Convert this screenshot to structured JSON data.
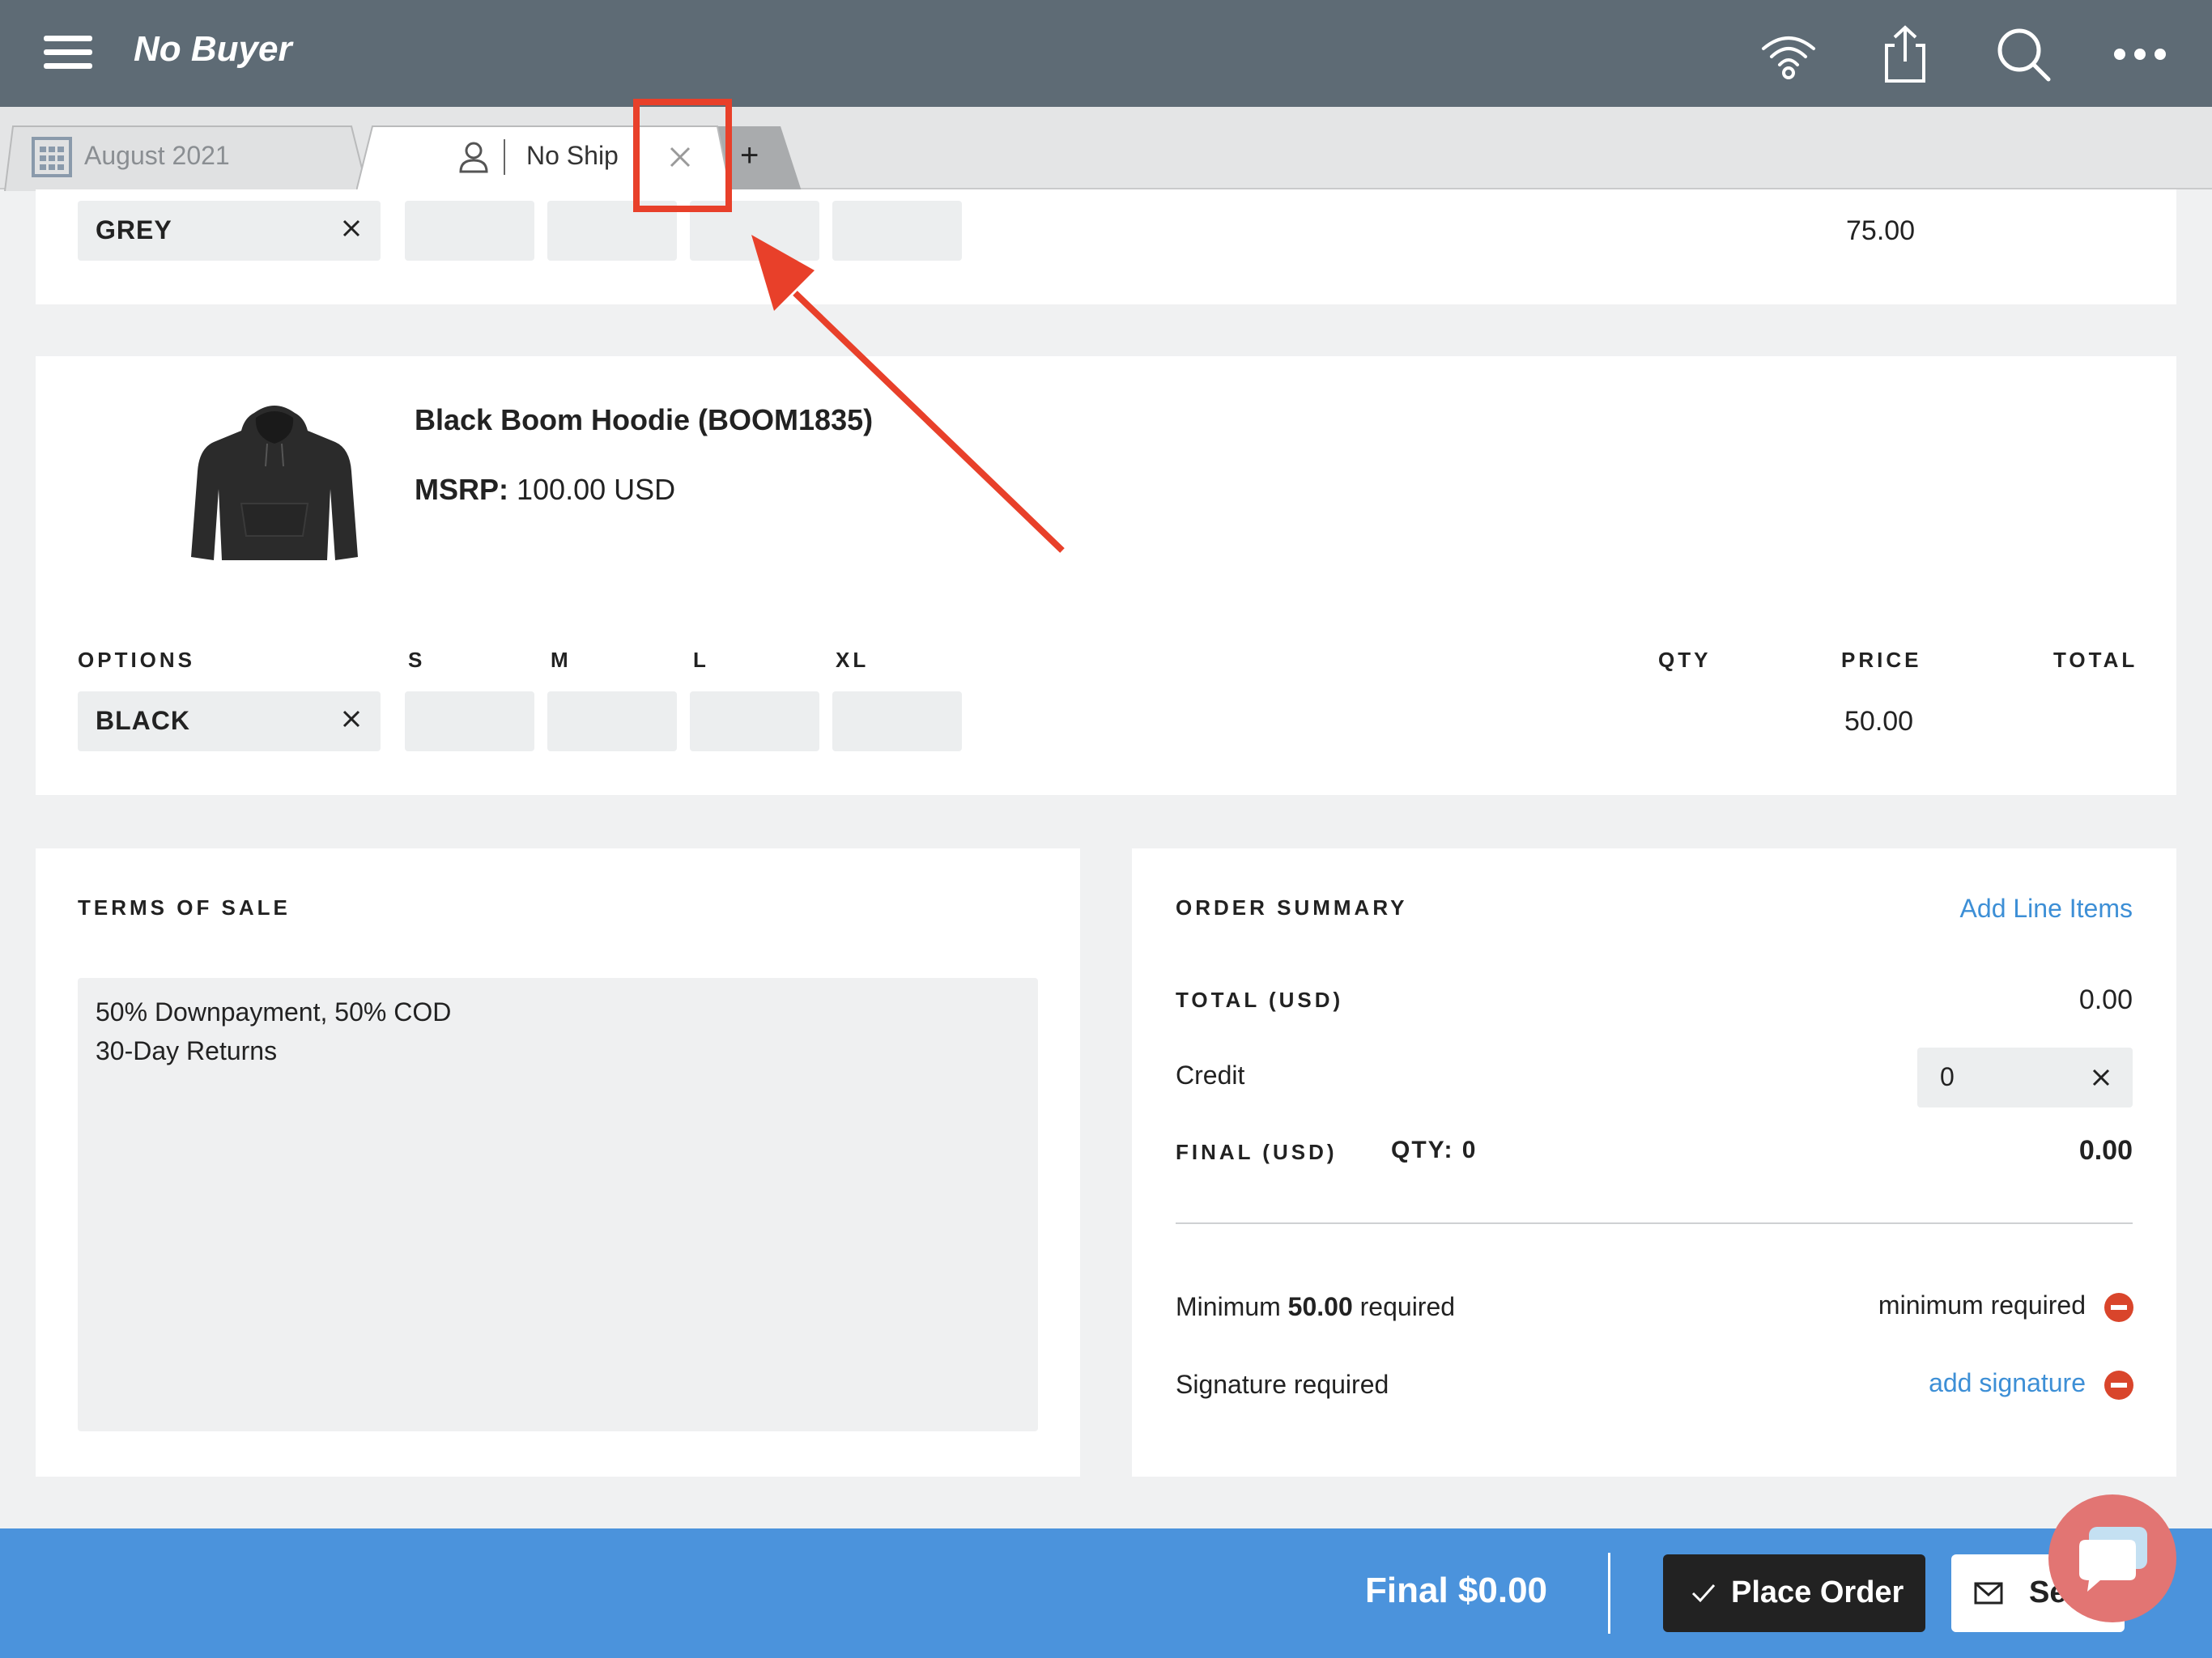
{
  "header": {
    "title": "No Buyer",
    "icons": [
      "menu-icon",
      "wifi-icon",
      "share-icon",
      "search-icon",
      "more-icon"
    ]
  },
  "tabs": [
    {
      "label": "August 2021",
      "icon": "calendar-icon"
    },
    {
      "label": "No Ship",
      "icon": "person-icon",
      "close": "close-icon"
    },
    {
      "label": "+"
    }
  ],
  "prev_item": {
    "option_value": "GREY",
    "price": "75.00"
  },
  "item": {
    "name": "Black Boom Hoodie (BOOM1835)",
    "msrp_label": "MSRP:",
    "msrp_value": "100.00 USD",
    "columns": {
      "options": "OPTIONS",
      "sizes": [
        "S",
        "M",
        "L",
        "XL"
      ],
      "qty": "QTY",
      "price": "PRICE",
      "total": "TOTAL"
    },
    "option_value": "BLACK",
    "price": "50.00"
  },
  "terms": {
    "heading": "TERMS OF SALE",
    "lines": [
      "50% Downpayment, 50% COD",
      "30-Day Returns"
    ]
  },
  "summary": {
    "heading": "ORDER SUMMARY",
    "add_line_items": "Add Line Items",
    "total_label": "TOTAL (USD)",
    "total_value": "0.00",
    "credit_label": "Credit",
    "credit_value": "0",
    "final_label": "FINAL (USD)",
    "qty_label": "QTY: 0",
    "final_value": "0.00",
    "minimum_prefix": "Minimum",
    "minimum_amount": "50.00",
    "minimum_suffix": "required",
    "minimum_status": "minimum required",
    "signature_label": "Signature required",
    "signature_action": "add signature"
  },
  "footer": {
    "final_text": "Final $0.00",
    "place_order": "Place Order",
    "send_partial": "Se"
  },
  "colors": {
    "topbar": "#5e6b75",
    "footer": "#4b93dc",
    "link": "#3d8fd6",
    "warning": "#d9452b",
    "annotation": "#e8402a"
  }
}
